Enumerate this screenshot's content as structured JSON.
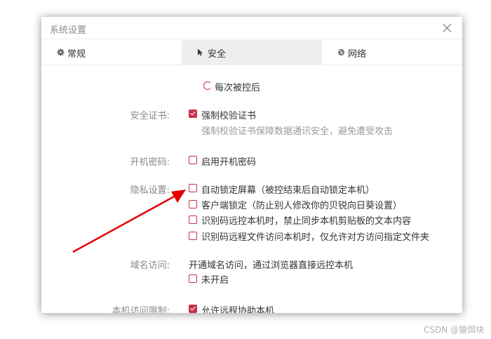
{
  "dialog": {
    "title": "系统设置"
  },
  "tabs": [
    {
      "label": "常规",
      "icon": "gear-icon"
    },
    {
      "label": "安全",
      "icon": "cursor-icon"
    },
    {
      "label": "网络",
      "icon": "globe-icon"
    }
  ],
  "active_tab": "安全",
  "colors": {
    "accent": "#c8334b",
    "annotation_arrow": "#e60000"
  },
  "security": {
    "top_option": "每次被控后",
    "cert": {
      "label": "安全证书:",
      "option": "强制校验证书",
      "checked": true,
      "hint": "强制校验证书保障数据通讯安全，避免遭受攻击"
    },
    "boot_password": {
      "label": "开机密码:",
      "option": "启用开机密码",
      "checked": false
    },
    "privacy": {
      "label": "隐私设置:",
      "options": [
        {
          "text": "自动锁定屏幕（被控结束后自动锁定本机）",
          "checked": false
        },
        {
          "text": "客户端锁定（防止别人修改你的贝锐向日葵设置）",
          "checked": false
        },
        {
          "text": "识别码远控本机时，禁止同步本机剪贴板的文本内容",
          "checked": false
        },
        {
          "text": "识别码远程文件访问本机时，仅允许对方访问指定文件夹",
          "checked": false
        }
      ]
    },
    "domain": {
      "label": "域名访问:",
      "description": "开通域名访问，通过浏览器直接远控本机",
      "option": "未开启",
      "checked": false
    },
    "access_limit": {
      "label": "本机访问限制:",
      "option": "允许远程协助本机",
      "checked": true
    }
  },
  "watermark": "CSDN @猿饵块"
}
